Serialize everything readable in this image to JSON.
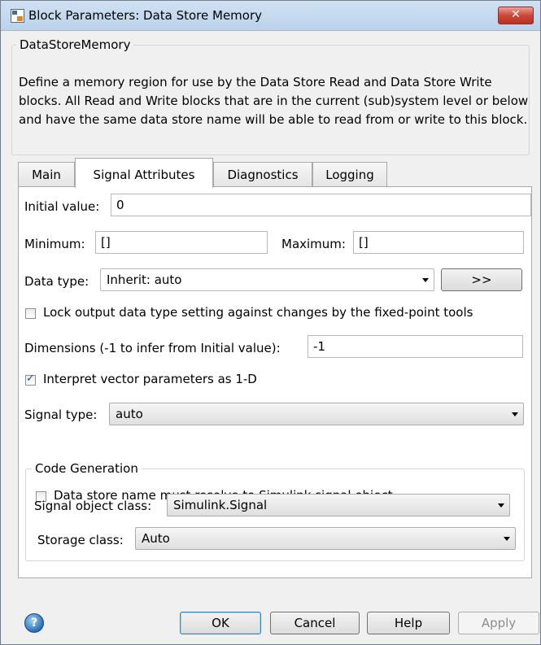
{
  "window": {
    "title": "Block Parameters: Data Store Memory",
    "close_glyph": "✕"
  },
  "description": {
    "legend": "DataStoreMemory",
    "text": "Define a memory region for use by the Data Store Read and Data Store Write blocks. All Read and Write blocks that are in the current (sub)system level or below and have the same data store name will be able to read from or write to this block."
  },
  "tabs": [
    {
      "label": "Main",
      "active": false
    },
    {
      "label": "Signal Attributes",
      "active": true
    },
    {
      "label": "Diagnostics",
      "active": false
    },
    {
      "label": "Logging",
      "active": false
    }
  ],
  "signal_attributes": {
    "initial_value_label": "Initial value:",
    "initial_value": "0",
    "minimum_label": "Minimum:",
    "minimum_value": "[]",
    "maximum_label": "Maximum:",
    "maximum_value": "[]",
    "data_type_label": "Data type:",
    "data_type_value": "Inherit: auto",
    "data_type_assistant_button": ">>",
    "lock_output_label": "Lock output data type setting against changes by the fixed-point tools",
    "lock_output_checked": false,
    "dimensions_label": "Dimensions (-1 to infer from Initial value):",
    "dimensions_value": "-1",
    "interpret_vector_label": "Interpret vector parameters as 1-D",
    "interpret_vector_checked": true,
    "signal_type_label": "Signal type:",
    "signal_type_value": "auto"
  },
  "code_generation": {
    "legend": "Code Generation",
    "resolve_label": "Data store name must resolve to Simulink signal object",
    "resolve_checked": false,
    "signal_object_class_label": "Signal object class:",
    "signal_object_class_value": "Simulink.Signal",
    "storage_class_label": "Storage class:",
    "storage_class_value": "Auto"
  },
  "buttons": {
    "ok": "OK",
    "cancel": "Cancel",
    "help": "Help",
    "apply": "Apply",
    "help_icon_glyph": "?"
  },
  "colors": {
    "titlebar": "#bcd3ea",
    "close_button": "#c9473a",
    "dialog_background": "#f0f0f0",
    "checkbox_mark": "#2a4e8a"
  }
}
